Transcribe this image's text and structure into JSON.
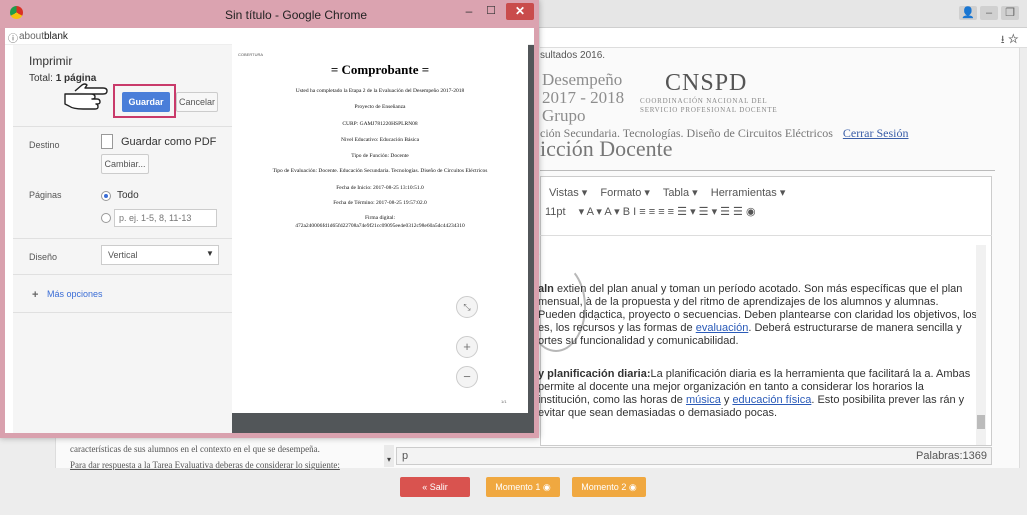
{
  "background": {
    "results_label": "sultados 2016.",
    "eval_lines": [
      "Desempeño",
      "2017 - 2018",
      "Grupo"
    ],
    "cnspd": {
      "title": "CNSPD",
      "subtitle1": "COORDINACIÓN NACIONAL DEL",
      "subtitle2": "SERVICIO PROFESIONAL DOCENTE"
    },
    "nav_text": "ción Secundaria. Tecnologías. Diseño de Circuitos Eléctricos",
    "nav_link": "Cerrar Sesión",
    "heading_fragment": "icción Docente",
    "left_T": "Ti",
    "right_os": "os",
    "editor": {
      "menubar": [
        "Vistas ▾",
        "Formato ▾",
        "Tabla ▾",
        "Herramientas ▾"
      ],
      "font_size": "11pt",
      "toolbar_glyphs": "▾  A ▾  A ▾   B   I   ≡  ≡  ≡  ≡   ☰ ▾  ☰ ▾  ☰  ☰   ◉",
      "paragraph1": {
        "pre": "aln ",
        "text": "extien del plan anual y toman un período acotado. Son más específicas que el plan mensual, à de la propuesta y del ritmo de aprendizajes de los alumnos y alumnas. Pueden dida̤ctica, proyecto o secuencias. Deben plantearse con claridad los objetivos, los es, los recursos y las formas de ",
        "link": "evaluación",
        "post": ". Deberá estructurarse de manera sencilla y ortes su funcionalidad y comunicabilidad."
      },
      "paragraph2": {
        "bold": "y planificación diaria:",
        "text": "La planificación diaria es la herramienta que facilitará la a. Ambas permite al docente una mejor organización en tanto a considerar los horarios la institución, como las horas de ",
        "link1": "música",
        "mid": " y ",
        "link2": "educación física",
        "post": ". Esto posibilita prever las rán y evitar que sean demasiadas o demasiado pocas."
      },
      "status_path": "p",
      "word_count": "Palabras:1369"
    },
    "left_text1": "características de sus alumnos en el contexto en el que se desempeña.",
    "left_text2": "Para dar respuesta a la Tarea Evaluativa deberas de considerar lo siguiente:",
    "buttons": {
      "salir": "« Salir",
      "momento1": "Momento 1 ◉",
      "momento2": "Momento 2 ◉"
    }
  },
  "popup": {
    "title": "Sin título - Google Chrome",
    "url_prefix": "about:",
    "url_strong": "blank",
    "print": {
      "title": "Imprimir",
      "total_label": "Total:",
      "total_value": "1 página",
      "save_button": "Guardar",
      "cancel_button": "Cancelar",
      "destination_label": "Destino",
      "destination_value": "Guardar como PDF",
      "change_button": "Cambiar...",
      "pages_label": "Páginas",
      "pages_all": "Todo",
      "pages_range_placeholder": "p. ej. 1-5, 8, 11-13",
      "layout_label": "Diseño",
      "layout_value": "Vertical",
      "more_options": "Más opciones"
    },
    "preview": {
      "corner": "COBERTURA",
      "title": "= Comprobante =",
      "lines": [
        "Usted ha completado la Etapa 2 de la Evaluación del Desempeño 2017-2018",
        "Proyecto de Enseñanza",
        "CURP: GAMJ781220HSPLRN08",
        "Nivel Educativo: Educación Básica",
        "Tipo de Función: Docente",
        "Tipo de Evaluación: Docente. Educación Secundaria. Tecnologías. Diseño de Circuitos Eléctricos",
        "Fecha de Inicio: 2017-08-25 13:10:51.0",
        "Fecha de Término: 2017-08-25 19:57:02.0",
        "Firma digital:",
        "472a240006fd1d65fd22708a74e9f21cc09095ee4e0312c98e60a5dc44234310"
      ],
      "page_number": "1/1"
    }
  }
}
